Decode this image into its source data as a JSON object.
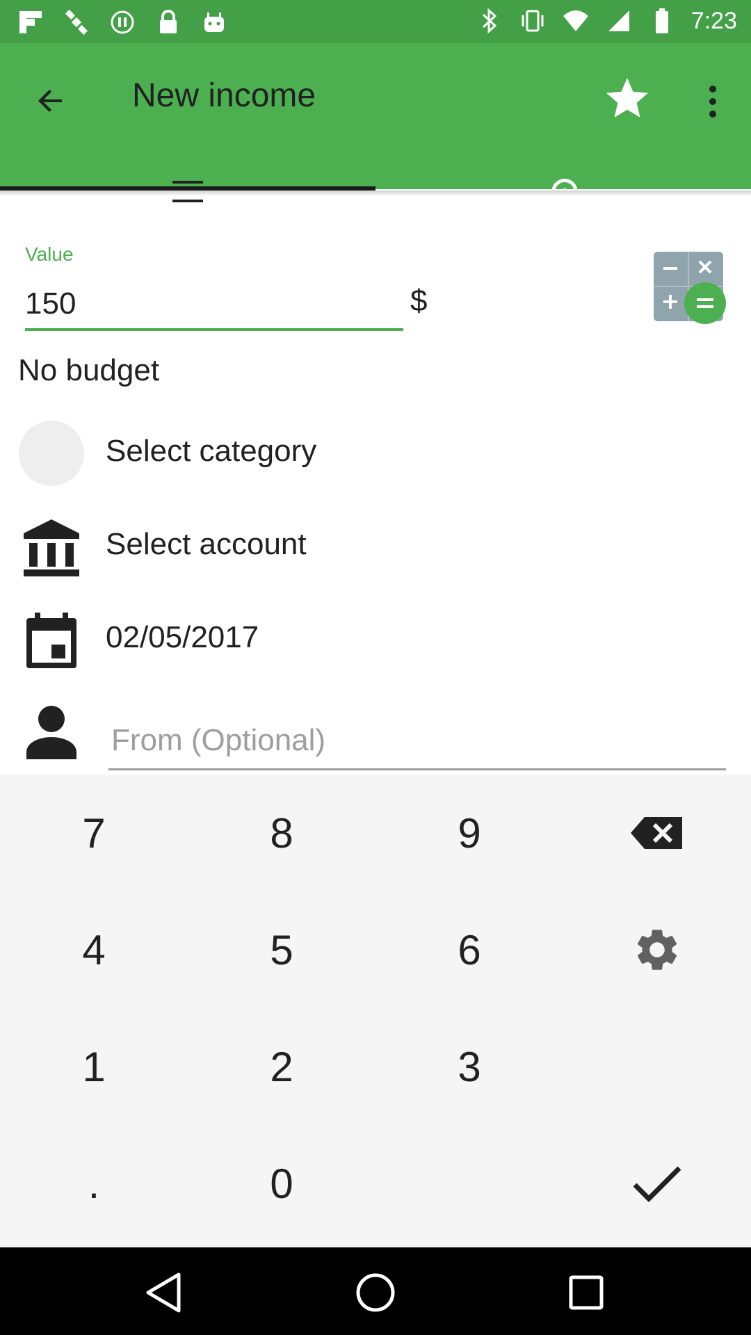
{
  "status_bar": {
    "time": "7:23",
    "left_icons": [
      "flipboard-icon",
      "satellite-icon",
      "pause-icon",
      "lock-icon",
      "android-icon"
    ],
    "right_icons": [
      "bluetooth-icon",
      "vibrate-icon",
      "wifi-icon",
      "signal-icon",
      "battery-icon"
    ]
  },
  "app_bar": {
    "title": "New income",
    "back_icon": "arrow-back-icon",
    "star_icon": "star-icon",
    "more_icon": "more-vert-icon"
  },
  "tabs": [
    {
      "name": "list",
      "icon": "list-icon",
      "selected": true
    },
    {
      "name": "history",
      "icon": "history-icon",
      "selected": false
    }
  ],
  "form": {
    "value_label": "Value",
    "value": "150",
    "currency": "$",
    "calculator_icon": "calculator-icon",
    "budget": "No budget",
    "category": "Select category",
    "account": "Select account",
    "date": "02/05/2017",
    "from_placeholder": "From (Optional)"
  },
  "keypad": {
    "k7": "7",
    "k8": "8",
    "k9": "9",
    "k4": "4",
    "k5": "5",
    "k6": "6",
    "k1": "1",
    "k2": "2",
    "k3": "3",
    "kdot": ".",
    "k0": "0",
    "backspace_icon": "backspace-icon",
    "settings_icon": "gear-icon",
    "confirm_icon": "check-icon"
  },
  "colors": {
    "primary": "#4caf50",
    "primary_dark": "#43a047",
    "keypad_bg": "#f5f5f5"
  }
}
